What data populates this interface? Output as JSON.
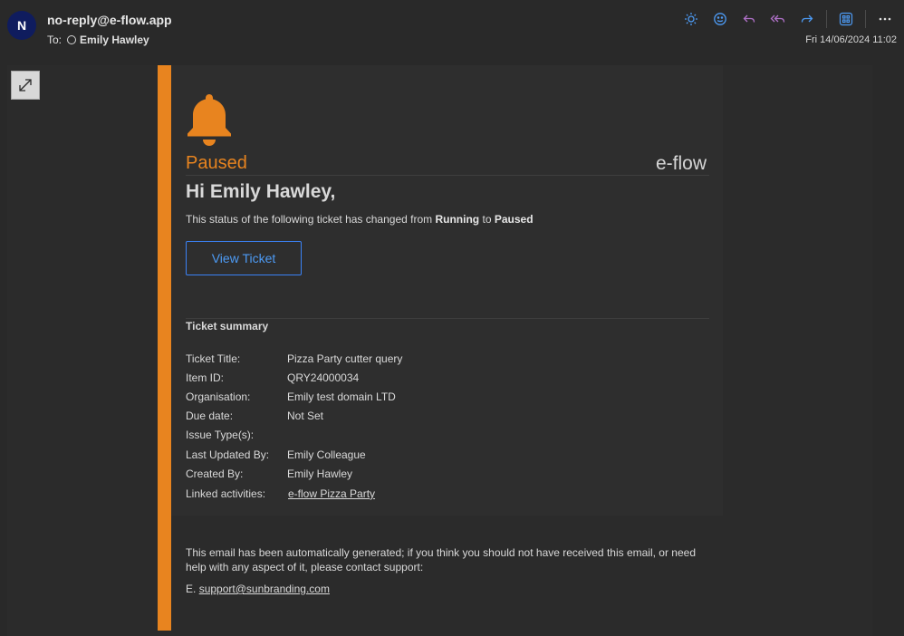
{
  "header": {
    "avatar_initial": "N",
    "sender": "no-reply@e-flow.app",
    "to_label": "To:",
    "to_name": "Emily Hawley",
    "date": "Fri 14/06/2024 11:02"
  },
  "toolbar": {
    "icons": [
      "brightness-icon",
      "emoji-icon",
      "reply-icon",
      "reply-all-icon",
      "forward-icon",
      "apps-icon",
      "more-icon"
    ],
    "icon_color": "#4d9bf5",
    "reply_color": "#b071c9"
  },
  "email": {
    "accent_color": "#e8841f",
    "status_word": "Paused",
    "brand": "e-flow",
    "greeting": "Hi Emily Hawley,",
    "status_prefix": "This status of the following ticket has changed from",
    "status_from": "Running",
    "status_to_word": "to",
    "status_to": "Paused",
    "view_button": "View Ticket",
    "summary_title": "Ticket summary",
    "summary": [
      {
        "label": "Ticket Title:",
        "value": "Pizza Party cutter query"
      },
      {
        "label": "Item ID:",
        "value": "QRY24000034"
      },
      {
        "label": "Organisation:",
        "value": "Emily test domain LTD"
      },
      {
        "label": "Due date:",
        "value": "Not Set"
      },
      {
        "label": "Issue Type(s):",
        "value": ""
      },
      {
        "label": "Last Updated By:",
        "value": "Emily Colleague"
      },
      {
        "label": "Created By:",
        "value": "Emily Hawley"
      }
    ],
    "linked_label": "Linked activities:",
    "linked_value": "e-flow Pizza Party",
    "footer_text": "This email has been automatically generated; if you think you should not have received this email, or need help with any aspect of it, please contact support:",
    "support_prefix": "E.",
    "support_email": "support@sunbranding.com"
  }
}
